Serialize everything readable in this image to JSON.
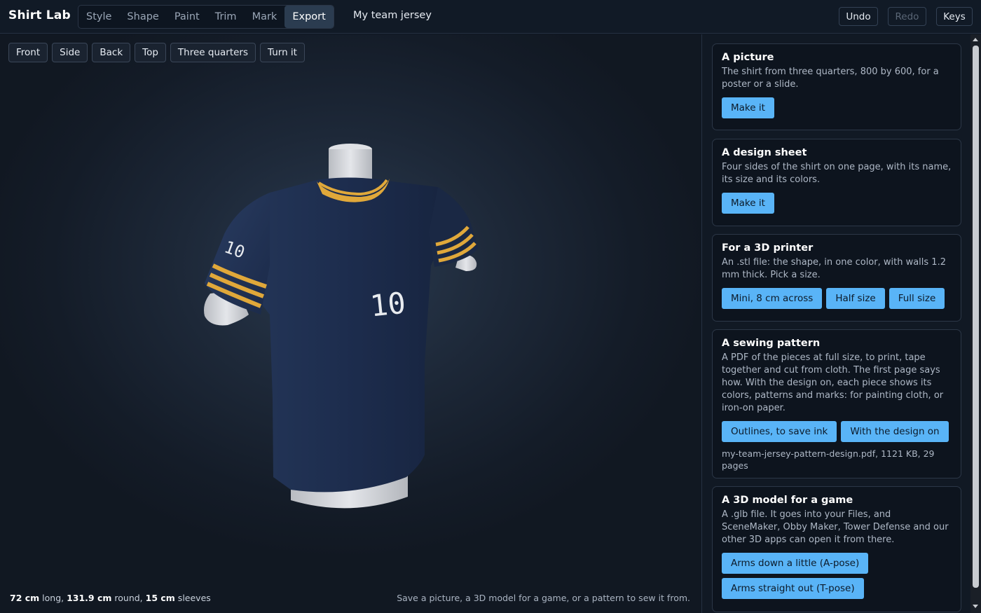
{
  "app": {
    "title": "Shirt Lab",
    "project_name": "My team jersey"
  },
  "tabs": [
    {
      "label": "Style",
      "active": false
    },
    {
      "label": "Shape",
      "active": false
    },
    {
      "label": "Paint",
      "active": false
    },
    {
      "label": "Trim",
      "active": false
    },
    {
      "label": "Mark",
      "active": false
    },
    {
      "label": "Export",
      "active": true
    }
  ],
  "toolbar": {
    "undo": "Undo",
    "redo": "Redo",
    "keys": "Keys",
    "redo_disabled": true
  },
  "views": [
    "Front",
    "Side",
    "Back",
    "Top",
    "Three quarters",
    "Turn it"
  ],
  "shirt": {
    "number": "10",
    "sleeve_number": "10",
    "body_color": "#1b2a4a",
    "trim_color": "#e0a83a",
    "mannequin_color": "#d6d8dc"
  },
  "stats": {
    "length_value": "72 cm",
    "length_label": " long, ",
    "round_value": "131.9 cm",
    "round_label": " round, ",
    "sleeve_value": "15 cm",
    "sleeve_label": " sleeves"
  },
  "hint": "Save a picture, a 3D model for a game, or a pattern to sew it from.",
  "export": {
    "picture": {
      "title": "A picture",
      "desc": "The shirt from three quarters, 800 by 600, for a poster or a slide.",
      "button": "Make it"
    },
    "design_sheet": {
      "title": "A design sheet",
      "desc": "Four sides of the shirt on one page, with its name, its size and its colors.",
      "button": "Make it"
    },
    "printer": {
      "title": "For a 3D printer",
      "desc": "An .stl file: the shape, in one color, with walls 1.2 mm thick. Pick a size.",
      "buttons": [
        "Mini, 8 cm across",
        "Half size",
        "Full size"
      ]
    },
    "sewing": {
      "title": "A sewing pattern",
      "desc": "A PDF of the pieces at full size, to print, tape together and cut from cloth. The first page says how. With the design on, each piece shows its colors, patterns and marks: for painting cloth, or iron-on paper.",
      "buttons": [
        "Outlines, to save ink",
        "With the design on"
      ],
      "file_info": "my-team-jersey-pattern-design.pdf, 1121 KB, 29 pages"
    },
    "game": {
      "title": "A 3D model for a game",
      "desc": "A .glb file. It goes into your Files, and SceneMaker, Obby Maker, Tower Defense and our other 3D apps can open it from there.",
      "buttons": [
        "Arms down a little (A-pose)",
        "Arms straight out (T-pose)"
      ]
    }
  }
}
